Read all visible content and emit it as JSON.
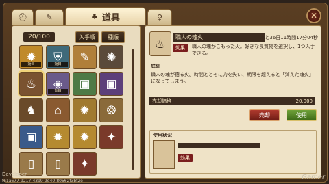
{
  "tabs": [
    {
      "label": "",
      "icon": "helmet-icon",
      "glyph": "⛑"
    },
    {
      "label": "",
      "icon": "scroll-icon",
      "glyph": "✎"
    },
    {
      "label": "道具",
      "icon": "pouch-icon",
      "glyph": "♣"
    },
    {
      "label": "",
      "icon": "chalice-icon",
      "glyph": "♀"
    }
  ],
  "close_icon": "close-icon",
  "inventory": {
    "count": "20/100",
    "sort_by_acquired": "入手順",
    "sort_by_type": "種順",
    "items": [
      {
        "icon": "medal-icon",
        "tag": "効目",
        "color": "#c08a2a"
      },
      {
        "icon": "shield-crest-icon",
        "tag": "効目",
        "color": "#3f6a7a"
      },
      {
        "icon": "scroll-icon",
        "tag": "",
        "color": "#b07f3a"
      },
      {
        "icon": "creature-icon",
        "tag": "",
        "color": "#5a4a3a"
      },
      {
        "icon": "fire-pot-icon",
        "tag": "",
        "color": "#7a5230"
      },
      {
        "icon": "crystal-icon",
        "tag": "効目",
        "color": "#6a5a8a"
      },
      {
        "icon": "green-book-icon",
        "tag": "",
        "color": "#4e7a46"
      },
      {
        "icon": "purple-book-icon",
        "tag": "",
        "color": "#5d3f7a"
      },
      {
        "icon": "warrior-icon",
        "tag": "",
        "color": "#6a4a2a"
      },
      {
        "icon": "shrine-icon",
        "tag": "",
        "color": "#8a5a30"
      },
      {
        "icon": "medal-icon",
        "tag": "",
        "color": "#a07a30"
      },
      {
        "icon": "ornament-icon",
        "tag": "",
        "color": "#8a6a3a"
      },
      {
        "icon": "blue-book-icon",
        "tag": "",
        "color": "#3a5a8a"
      },
      {
        "icon": "medal-icon",
        "tag": "",
        "color": "#b58a30"
      },
      {
        "icon": "medal-icon",
        "tag": "",
        "color": "#b58a30"
      },
      {
        "icon": "crest-icon",
        "tag": "",
        "color": "#7a3a2a"
      },
      {
        "icon": "ticket-icon",
        "tag": "",
        "color": "#9a7a4a"
      },
      {
        "icon": "ticket-icon",
        "tag": "",
        "color": "#9a7a4a"
      },
      {
        "icon": "crest-icon",
        "tag": "",
        "color": "#7a3a2a"
      }
    ]
  },
  "detail": {
    "item_icon": "fire-pot-icon",
    "item_name": "職人の魂火",
    "remaining_time": "あと36日11時間17分04秒",
    "effect_badge": "効果",
    "effect_text": "職人の魂がこもった火。好きな良質物を選択し、1つ入手できる。",
    "detail_label": "詳細",
    "detail_text": "職人の魂が宿る火。時間とともに力を失い、期限を超えると「消えた魂火」になってしまう。",
    "price_label": "売却価格",
    "price_value": "20,000",
    "sell_button": "売却",
    "use_button": "使用",
    "usage_label": "使用状況",
    "usage_effect_badge": "効果"
  },
  "footer": {
    "developer_label": "Developer",
    "device_id": "f61a677-9217-4399-9d40-80562f3bf2e",
    "watermark": "Gamer"
  }
}
